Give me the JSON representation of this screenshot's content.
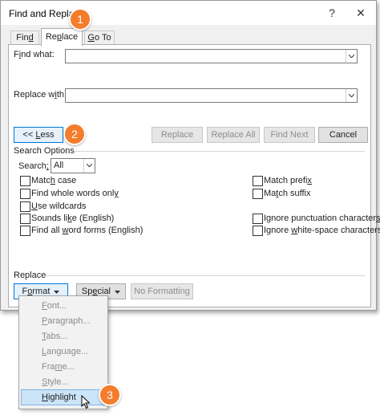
{
  "window": {
    "title": "Find and Replace",
    "help_glyph": "?",
    "close_glyph": "✕"
  },
  "tabs": [
    {
      "pre": "Fin",
      "key": "d",
      "post": ""
    },
    {
      "pre": "Re",
      "key": "p",
      "post": "lace"
    },
    {
      "pre": "",
      "key": "G",
      "post": "o To"
    }
  ],
  "active_tab": "Replace",
  "find": {
    "pre": "F",
    "key": "i",
    "post": "nd what:",
    "value": ""
  },
  "replace": {
    "pre": "Replace w",
    "key": "i",
    "post": "th:",
    "value": ""
  },
  "buttons": {
    "less": {
      "pre": "<< ",
      "key": "L",
      "post": "ess"
    },
    "replace": "Replace",
    "replace_all": "Replace All",
    "find_next": "Find Next",
    "cancel": "Cancel"
  },
  "search_options": {
    "heading": "Search Options",
    "search_label_pre": "Search",
    "search_label_key": ";",
    "search_value": "All"
  },
  "checkboxes_left": [
    {
      "pre": "Matc",
      "key": "h",
      "post": " case"
    },
    {
      "pre": "Find whole words onl",
      "key": "y",
      "post": ""
    },
    {
      "pre": "",
      "key": "U",
      "post": "se wildcards"
    },
    {
      "pre": "Sounds li",
      "key": "k",
      "post": "e (English)"
    },
    {
      "pre": "Find all ",
      "key": "w",
      "post": "ord forms (English)"
    }
  ],
  "checkboxes_right": [
    {
      "pre": "Match prefi",
      "key": "x",
      "post": ""
    },
    {
      "pre": "Ma",
      "key": "t",
      "post": "ch suffix"
    },
    {
      "pre": "Ignore punctuation character",
      "key": "s",
      "post": ""
    },
    {
      "pre": "Ignore ",
      "key": "w",
      "post": "hite-space characters"
    }
  ],
  "replace_section": {
    "heading": "Replace",
    "format": {
      "pre": "F",
      "key": "o",
      "post": "rmat"
    },
    "special": {
      "pre": "Sp",
      "key": "e",
      "post": "cial"
    },
    "no_formatting": "No Formatting"
  },
  "format_menu": [
    {
      "pre": "",
      "key": "F",
      "post": "ont...",
      "enabled": false
    },
    {
      "pre": "",
      "key": "P",
      "post": "aragraph...",
      "enabled": false
    },
    {
      "pre": "",
      "key": "T",
      "post": "abs...",
      "enabled": false
    },
    {
      "pre": "",
      "key": "L",
      "post": "anguage...",
      "enabled": false
    },
    {
      "pre": "Fra",
      "key": "m",
      "post": "e...",
      "enabled": false
    },
    {
      "pre": "",
      "key": "S",
      "post": "tyle...",
      "enabled": false
    },
    {
      "pre": "",
      "key": "H",
      "post": "ighlight",
      "enabled": true
    }
  ],
  "callouts": [
    "1",
    "2",
    "3"
  ],
  "colors": {
    "callout": "#f47c2b",
    "menu_highlight": "#cce4f7",
    "focus_border": "#0078d7"
  }
}
